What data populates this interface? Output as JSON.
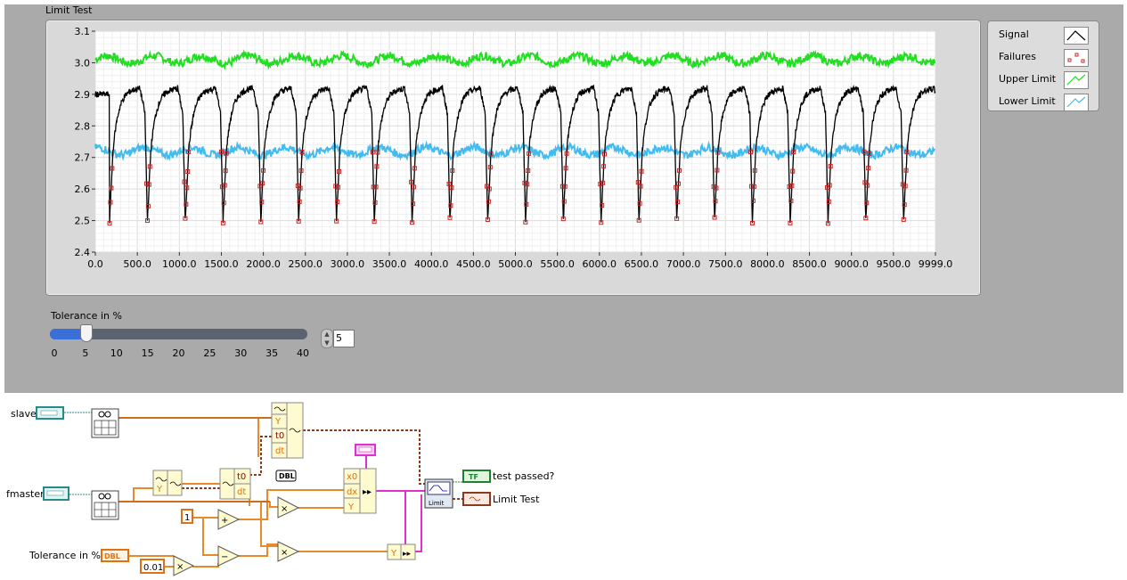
{
  "front_panel": {
    "graph_label": "Limit Test",
    "slider": {
      "label": "Tolerance in %",
      "value": 5,
      "min": 0,
      "max": 40,
      "ticks": [
        "0",
        "5",
        "10",
        "15",
        "20",
        "25",
        "30",
        "35",
        "40"
      ],
      "numeric_value": "5"
    }
  },
  "legend": {
    "items": [
      {
        "label": "Signal",
        "color": "#000000"
      },
      {
        "label": "Failures",
        "color": "#cc2222"
      },
      {
        "label": "Upper Limit",
        "color": "#22dd22"
      },
      {
        "label": "Lower Limit",
        "color": "#44bbee"
      }
    ]
  },
  "chart_data": {
    "type": "line",
    "title": "Limit Test",
    "xlim": [
      0,
      9999
    ],
    "ylim": [
      2.4,
      3.1
    ],
    "x_ticks": [
      "0.0",
      "500.0",
      "1000.0",
      "1500.0",
      "2000.0",
      "2500.0",
      "3000.0",
      "3500.0",
      "4000.0",
      "4500.0",
      "5000.0",
      "5500.0",
      "6000.0",
      "6500.0",
      "7000.0",
      "7500.0",
      "8000.0",
      "8500.0",
      "9000.0",
      "9500.0",
      "9999.0"
    ],
    "y_ticks": [
      "2.4",
      "2.5",
      "2.6",
      "2.7",
      "2.8",
      "2.9",
      "3.0",
      "3.1"
    ],
    "grid": true,
    "legend_position": "right",
    "signal": {
      "name": "Signal",
      "color": "#000000",
      "period": 450,
      "first_drop": 170,
      "peak": 2.92,
      "minimum": 2.5,
      "cycles": 22
    },
    "series": [
      {
        "name": "Upper Limit",
        "color": "#22dd22",
        "mean": 3.01,
        "amplitude": 0.02
      },
      {
        "name": "Lower Limit",
        "color": "#44bbee",
        "mean": 2.72,
        "amplitude": 0.02
      }
    ],
    "failures": {
      "name": "Failures",
      "color": "#cc2222",
      "threshold": 2.72
    }
  },
  "block_diagram": {
    "labels": {
      "slave": "slave",
      "fmaster": "fmaster",
      "tolerance": "Tolerance in %",
      "test_passed": "test passed?",
      "limit_test": "Limit Test",
      "const_one": "1",
      "const_pct": "0.01",
      "dbl": "DBL",
      "tf": "TF",
      "t0": "t0",
      "dt": "dt",
      "x0": "x0",
      "dx": "dx",
      "y": "Y",
      "limit": "Limit",
      "plus": "+",
      "minus": "−",
      "times": "×"
    }
  }
}
